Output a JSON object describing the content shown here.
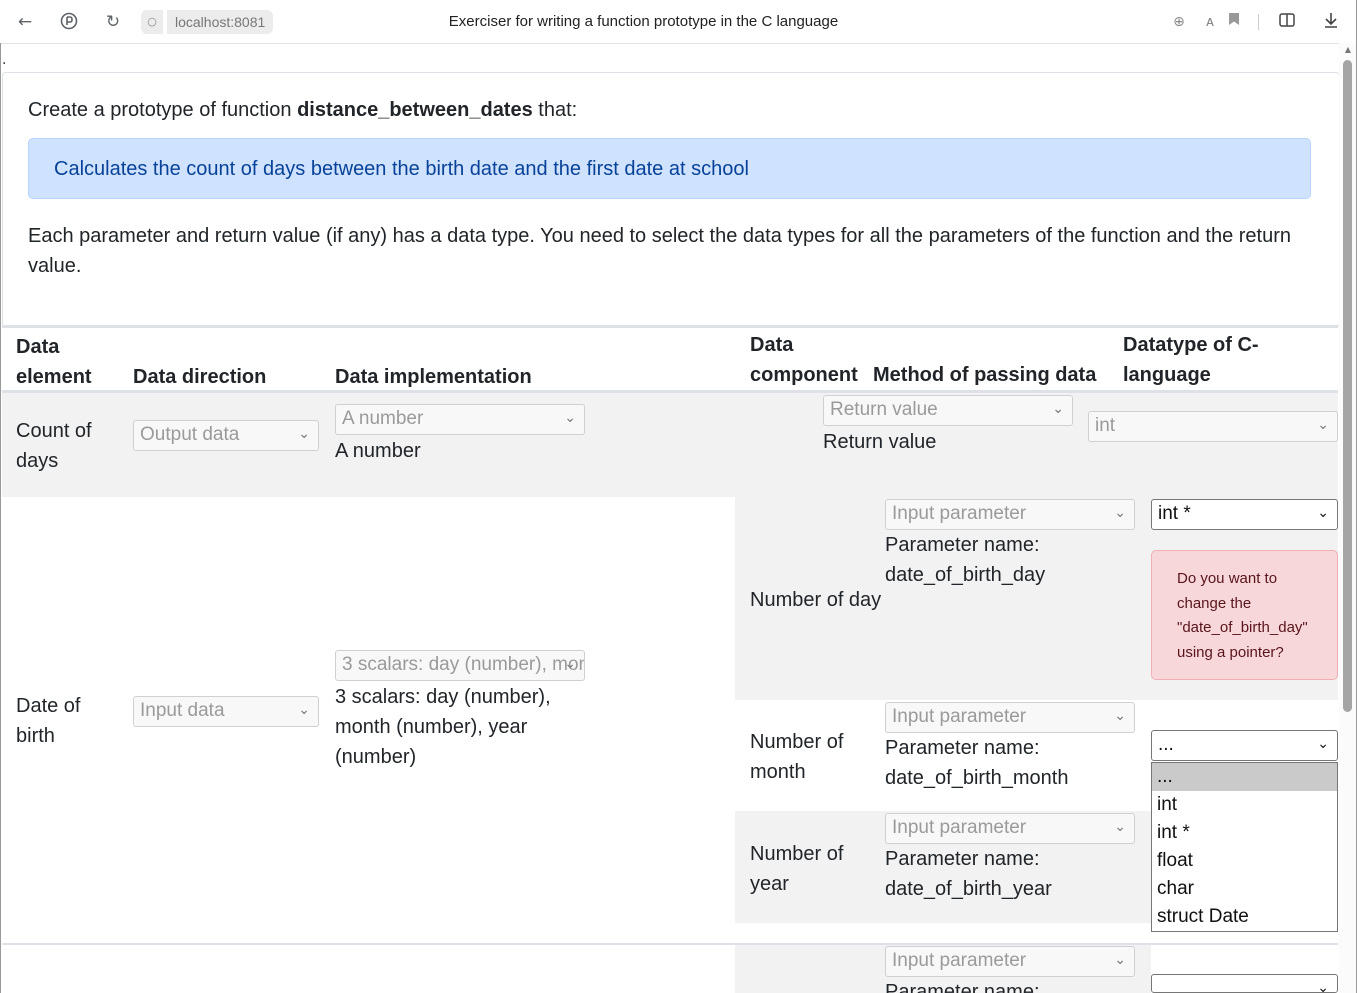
{
  "browser": {
    "url": "localhost:8081",
    "title": "Exerciser for writing a function prototype in the C language"
  },
  "page_dot": ".",
  "task": {
    "prefix": "Create a prototype of function",
    "function_name": "distance_between_dates",
    "suffix": "that:",
    "description": "Calculates the count of days between the birth date and the first date at school",
    "explanation": "Each parameter and return value (if any) has a data type. You need to select the data types for all the parameters of the function and the return value."
  },
  "table": {
    "headers": {
      "element": "Data element",
      "direction": "Data direction",
      "implementation": "Data implementation",
      "component": "Data component",
      "passing": "Method of passing data",
      "ctype": "Datatype of C-language"
    },
    "rows": [
      {
        "element": "Count of days",
        "direction": "Output data",
        "impl_select": "A number",
        "impl_text": "A number",
        "components": [
          {
            "name": "",
            "passing_select": "Return value",
            "passing_text": "Return value",
            "type_select": "int"
          }
        ]
      },
      {
        "element": "Date of birth",
        "direction": "Input data",
        "impl_select": "3 scalars: day (number), month (number), year (number)",
        "impl_text": "3 scalars: day (number), month (number), year (number)",
        "components": [
          {
            "name": "Number of day",
            "passing_select": "Input parameter",
            "param_label": "Parameter name:",
            "param_name": "date_of_birth_day",
            "type_select": "int *",
            "warning": "Do you want to change the \"date_of_birth_day\" using a pointer?"
          },
          {
            "name": "Number of month",
            "passing_select": "Input parameter",
            "param_label": "Parameter name:",
            "param_name": "date_of_birth_month",
            "type_select": "..."
          },
          {
            "name": "Number of year",
            "passing_select": "Input parameter",
            "param_label": "Parameter name:",
            "param_name": "date_of_birth_year"
          }
        ]
      },
      {
        "passing_select": "Input parameter",
        "param_label": "Parameter name:"
      }
    ]
  },
  "type_dropdown": {
    "options": [
      "...",
      "int",
      "int *",
      "float",
      "char",
      "struct Date"
    ],
    "highlighted": "..."
  }
}
